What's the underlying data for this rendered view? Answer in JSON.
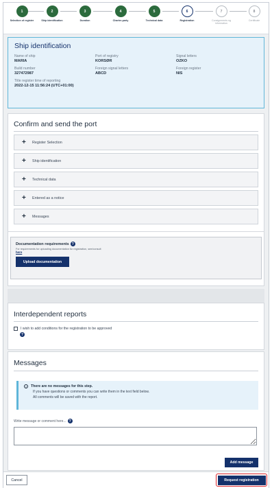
{
  "stepper": {
    "steps": [
      {
        "number": "1",
        "label": "Selection of register",
        "state": "done"
      },
      {
        "number": "2",
        "label": "Ship identification",
        "state": "done"
      },
      {
        "number": "3",
        "label": "Duration",
        "state": "done"
      },
      {
        "number": "4",
        "label": "Charter-party",
        "state": "done"
      },
      {
        "number": "5",
        "label": "Technical data",
        "state": "done"
      },
      {
        "number": "6",
        "label": "Registration",
        "state": "current"
      },
      {
        "number": "7",
        "label": "Consignments ng information",
        "state": "todo"
      },
      {
        "number": "8",
        "label": "Certificate",
        "state": "todo"
      }
    ]
  },
  "ship_identification": {
    "title": "Ship identification",
    "fields": {
      "name_label": "Name of ship",
      "name_value": "MARIA",
      "port_label": "Port of registry",
      "port_value": "KORSØR",
      "signal_label": "Signal letters",
      "signal_value": "OZKO",
      "build_label": "Build number",
      "build_value": "327472987",
      "foreign_signal_label": "Foreign signal letters",
      "foreign_signal_value": "ABCD",
      "foreign_register_label": "Foreign register",
      "foreign_register_value": "NIS",
      "title_time_label": "Title register time of reporting",
      "title_time_value": "2022-12-15 11:56:24 (UTC+01:00)"
    }
  },
  "confirm": {
    "title": "Confirm and send the port",
    "items": [
      "Register Selection",
      "Ship identification",
      "Technical data",
      "Entered as a notice",
      "Messages"
    ]
  },
  "documentation": {
    "title": "Documentation requirements",
    "text": "For requirements for uploading documentation for registration, see/consult",
    "link": "here",
    "upload_label": "Upload documentation"
  },
  "interdependent": {
    "title": "Interdependent reports",
    "checkbox_label": "I wish to add conditions for the registration to be approved"
  },
  "messages": {
    "title": "Messages",
    "info_title": "There are no messages for this step.",
    "info_line1": "If you have questions or comments you can write them in the text field below.",
    "info_line2": "All comments will be saved with the report.",
    "input_label": "Write message or comment here...",
    "add_label": "Add message"
  },
  "footer": {
    "cancel_label": "Cancel",
    "request_label": "Request registration"
  },
  "colors": {
    "primary": "#14316b",
    "step_done": "#2c6b3d",
    "info_border": "#5fb6d9",
    "highlight": "#d8232a"
  }
}
